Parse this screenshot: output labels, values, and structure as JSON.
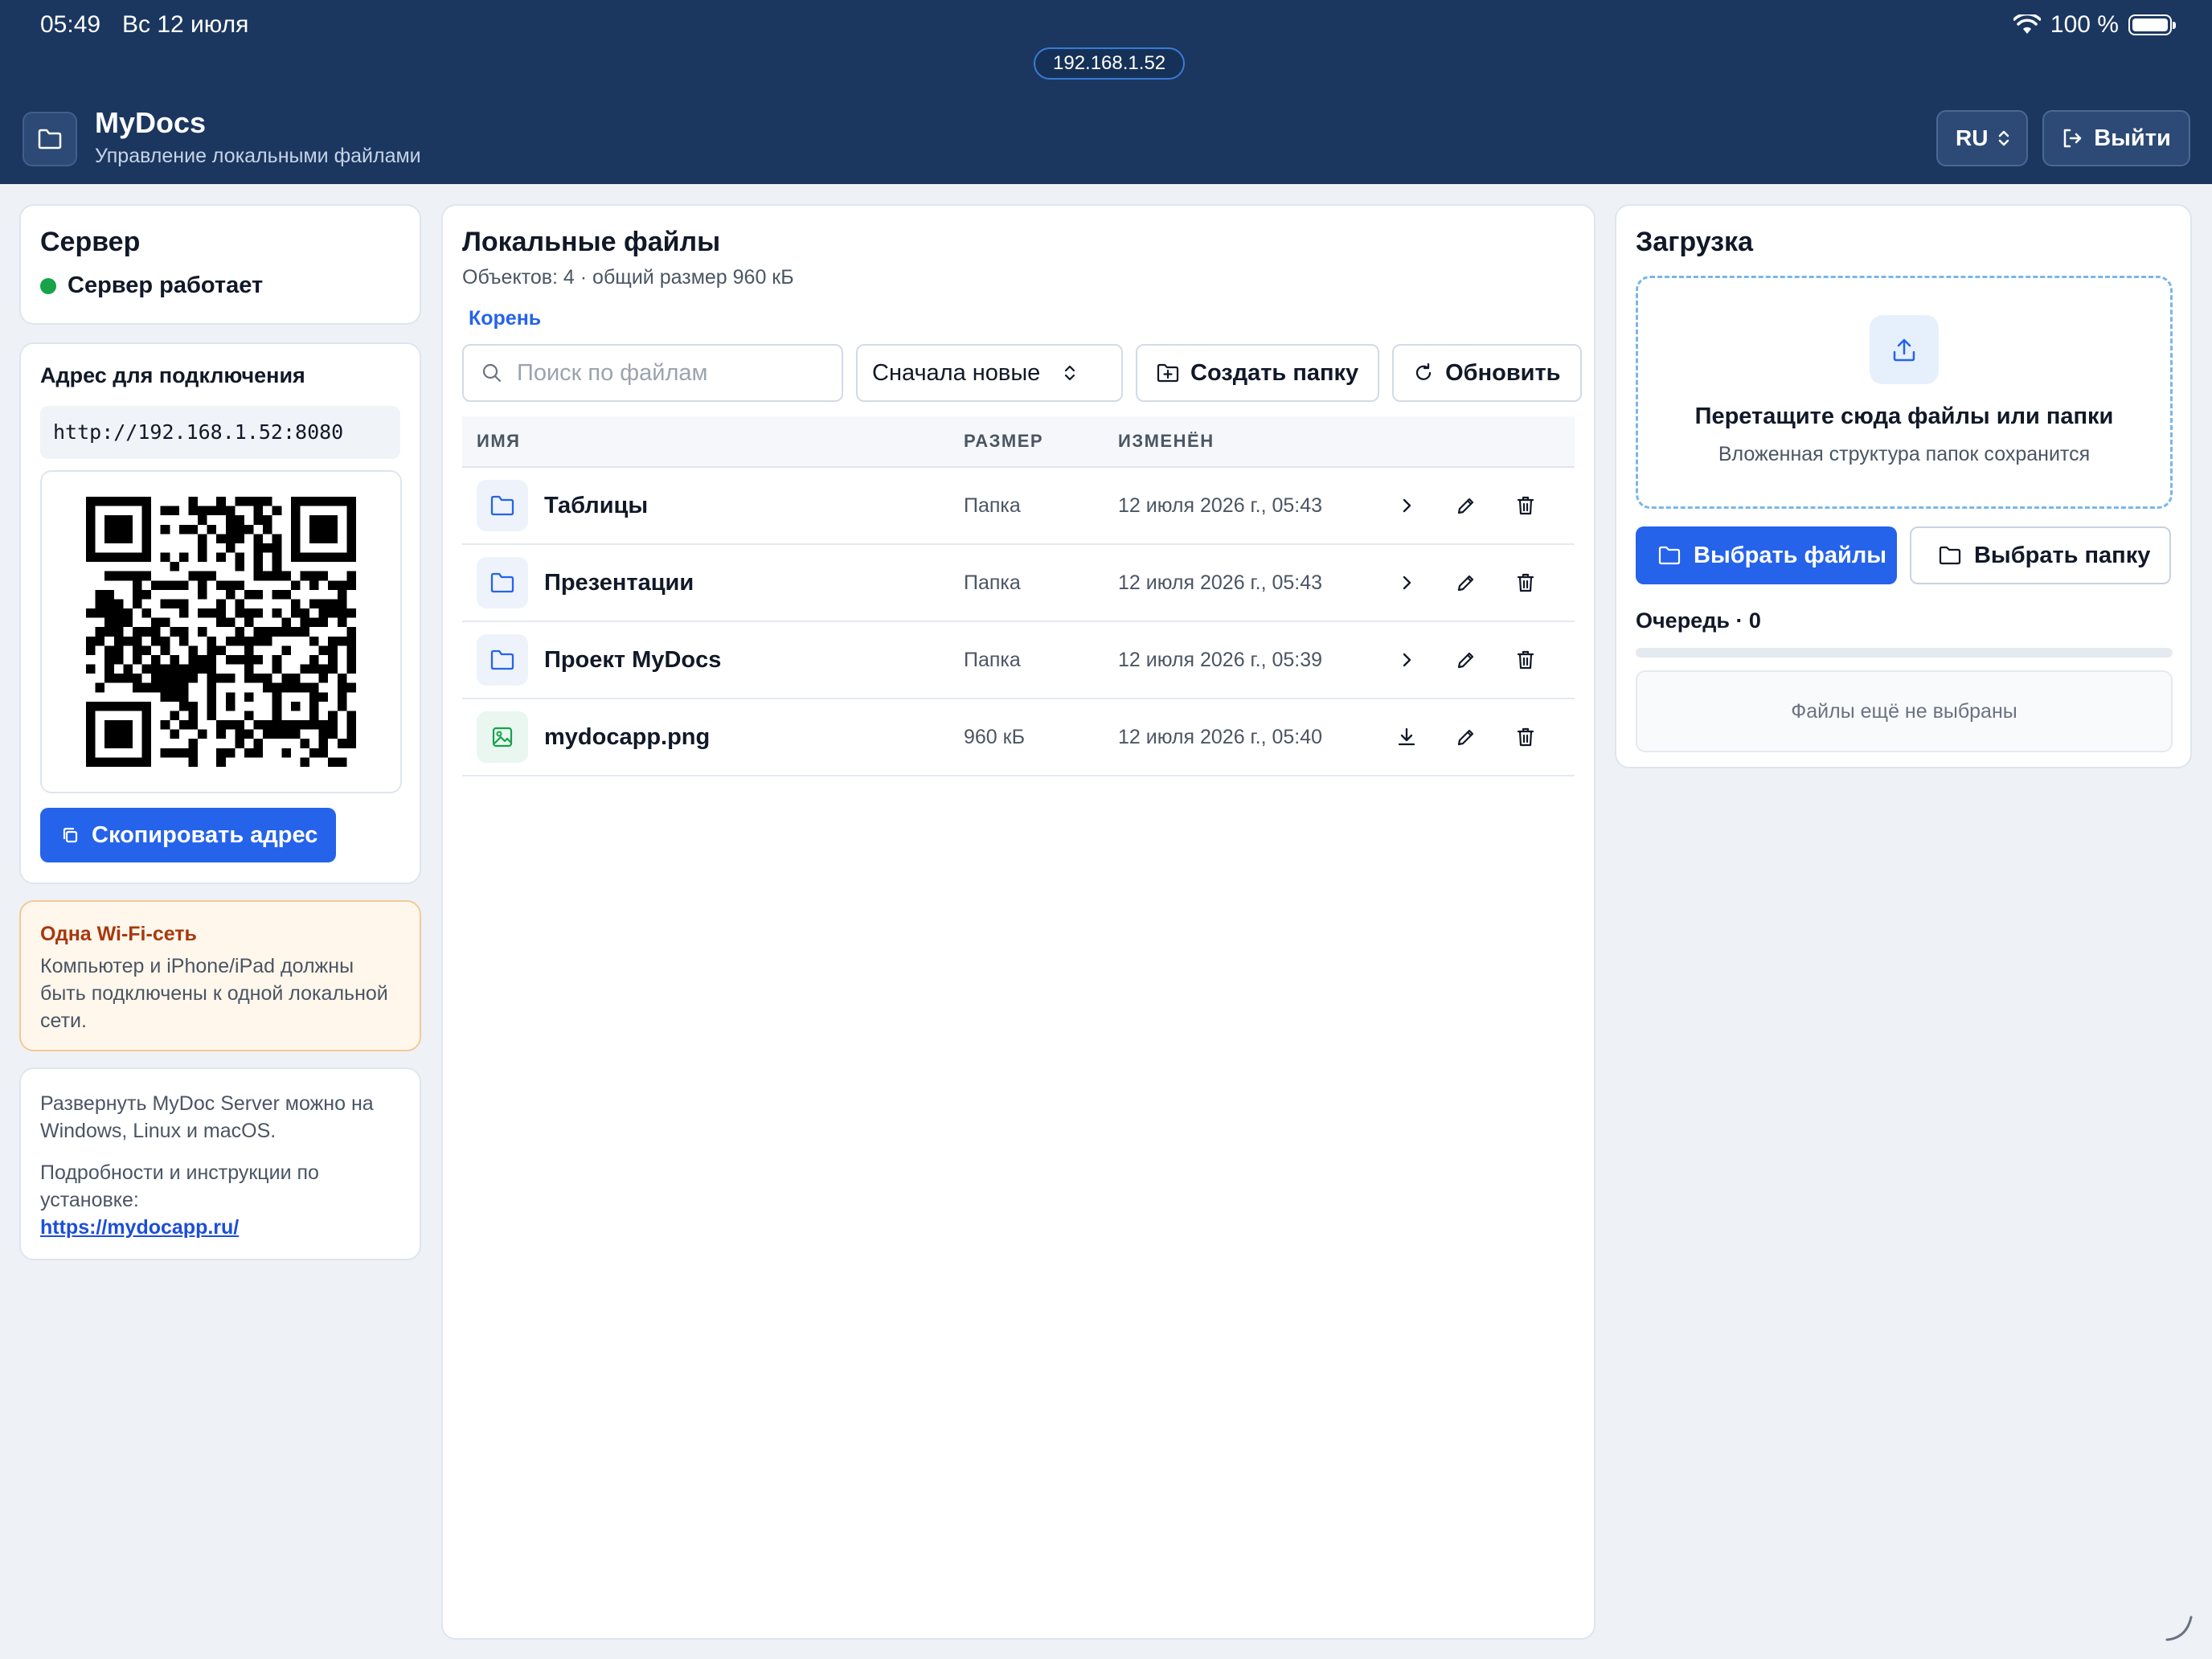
{
  "status_bar": {
    "time": "05:49",
    "date": "Вс 12 июля",
    "battery": "100 %"
  },
  "ip_pill": "192.168.1.52",
  "header": {
    "title": "MyDocs",
    "subtitle": "Управление локальными файлами",
    "lang": "RU",
    "logout_label": "Выйти"
  },
  "server": {
    "title": "Сервер",
    "status": "Сервер работает",
    "status_color": "#16a34a"
  },
  "address": {
    "label": "Адрес для подключения",
    "url": "http://192.168.1.52:8080",
    "copy_label": "Скопировать адрес"
  },
  "wifi_note": {
    "title": "Одна Wi-Fi-сеть",
    "text": "Компьютер и iPhone/iPad должны быть подключены к одной локальной сети."
  },
  "info": {
    "text1": "Развернуть MyDoc Server можно на Windows, Linux и macOS.",
    "text2": "Подробности и инструкции по установке:",
    "link": "https://mydocapp.ru/"
  },
  "files": {
    "title": "Локальные файлы",
    "meta": "Объектов: 4 · общий размер 960 кБ",
    "breadcrumb": "Корень",
    "search_placeholder": "Поиск по файлам",
    "sort_value": "Сначала новые",
    "create_folder_label": "Создать папку",
    "refresh_label": "Обновить",
    "columns": {
      "name": "ИМЯ",
      "size": "РАЗМЕР",
      "modified": "ИЗМЕНЁН"
    },
    "rows": [
      {
        "name": "Таблицы",
        "size": "Папка",
        "modified": "12 июля 2026 г., 05:43",
        "type": "folder",
        "icon": "folder-icon"
      },
      {
        "name": "Презентации",
        "size": "Папка",
        "modified": "12 июля 2026 г., 05:43",
        "type": "folder",
        "icon": "folder-icon"
      },
      {
        "name": "Проект MyDocs",
        "size": "Папка",
        "modified": "12 июля 2026 г., 05:39",
        "type": "folder",
        "icon": "folder-icon"
      },
      {
        "name": "mydocapp.png",
        "size": "960 кБ",
        "modified": "12 июля 2026 г., 05:40",
        "type": "image",
        "icon": "image-icon"
      }
    ]
  },
  "upload": {
    "title": "Загрузка",
    "drop_title": "Перетащите сюда файлы или папки",
    "drop_sub": "Вложенная структура папок сохранится",
    "choose_files_label": "Выбрать файлы",
    "choose_folder_label": "Выбрать папку",
    "queue_label": "Очередь · 0",
    "queue_progress": 0,
    "empty_label": "Файлы ещё не выбраны"
  },
  "colors": {
    "header_bg": "#1b3760",
    "accent": "#2563eb",
    "warning_bg": "#fff7ec",
    "warning_title": "#a8380e"
  }
}
